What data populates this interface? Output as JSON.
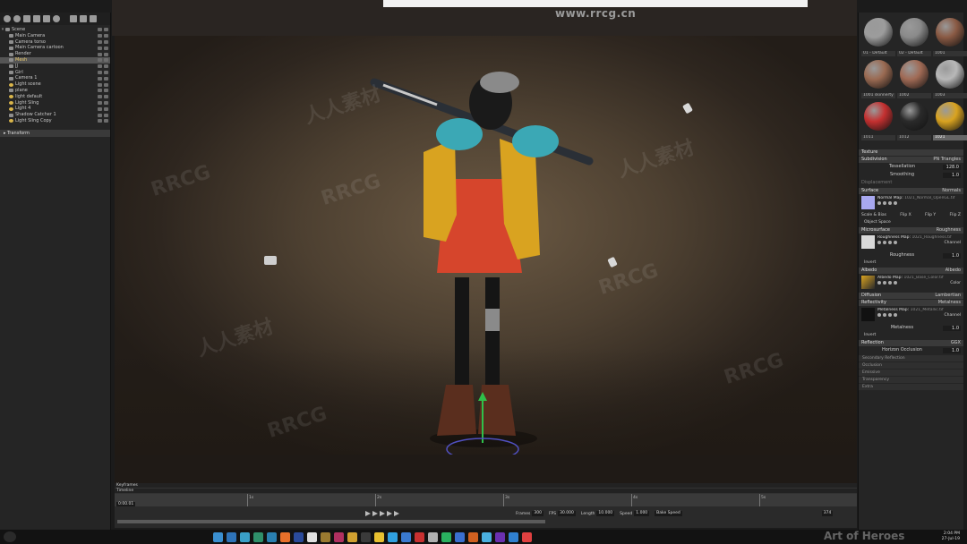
{
  "watermark": {
    "url": "www.rrcg.cn",
    "brand_latin": "RRCG",
    "brand_cn": "人人素材",
    "corner": "Art of Heroes"
  },
  "scene_tree": {
    "items": [
      {
        "label": "Scene",
        "type": "root"
      },
      {
        "label": "Main Camera",
        "type": "camera"
      },
      {
        "label": "Camera torso",
        "type": "camera"
      },
      {
        "label": "Main Camera cartoon",
        "type": "camera"
      },
      {
        "label": "Render",
        "type": "object"
      },
      {
        "label": "Mesh",
        "type": "object",
        "selected": true
      },
      {
        "label": "JJ",
        "type": "object"
      },
      {
        "label": "Girl",
        "type": "object"
      },
      {
        "label": "Camera 1",
        "type": "camera"
      },
      {
        "label": "Light scene",
        "type": "light"
      },
      {
        "label": "plane",
        "type": "object"
      },
      {
        "label": "light default",
        "type": "light"
      },
      {
        "label": "Light Sling",
        "type": "light"
      },
      {
        "label": "Light 4",
        "type": "light"
      },
      {
        "label": "Shadow Catcher 1",
        "type": "object"
      },
      {
        "label": "Light Sling Copy",
        "type": "light"
      }
    ],
    "transform_label": "Transform"
  },
  "materials": [
    {
      "label": "01 - Default",
      "color": "#9c9c9c"
    },
    {
      "label": "02 - Default",
      "color": "#8a8a8a"
    },
    {
      "label": "1001",
      "color": "#8a5a44"
    },
    {
      "label": "1001 skinnerty",
      "color": "#9a6a52"
    },
    {
      "label": "1002",
      "color": "#a06a55"
    },
    {
      "label": "1003",
      "color": "#b8b8b8"
    },
    {
      "label": "1011",
      "color": "#c43030"
    },
    {
      "label": "1012",
      "color": "#2a2a2a"
    },
    {
      "label": "1021",
      "color": "#d9a320",
      "selected": true
    }
  ],
  "properties": {
    "texture_label": "Texture",
    "subdivision": {
      "label": "Subdivision",
      "value": "PN Triangles",
      "tessellation_label": "Tessellation",
      "tessellation": "128.0",
      "smoothing_label": "Smoothing",
      "smoothing": "1.0"
    },
    "displacement": "Displacement",
    "surface": {
      "label": "Surface",
      "value": "Normals",
      "map_label": "Normal Map:",
      "map_file": "1021_Normal_OpenGL.tif",
      "scale_bias": "Scale & Bias",
      "flip_x": "Flip X",
      "flip_y": "Flip Y",
      "flip_z": "Flip Z",
      "object_space": "Object Space"
    },
    "microsurface": {
      "label": "Microsurface",
      "value": "Roughness",
      "map_label": "Roughness Map:",
      "map_file": "1021_Roughness.tif",
      "channel": "Channel",
      "roughness_label": "Roughness",
      "roughness": "1.0",
      "invert": "Invert"
    },
    "albedo": {
      "label": "Albedo",
      "value": "Albedo",
      "map_label": "Albedo Map:",
      "map_file": "1021_Base_Color.tif",
      "color": "Color"
    },
    "diffusion": {
      "label": "Diffusion",
      "value": "Lambertian"
    },
    "reflectivity": {
      "label": "Reflectivity",
      "value": "Metalness",
      "map_label": "Metalness Map:",
      "map_file": "1021_Metallic.tif",
      "channel": "Channel",
      "metalness_label": "Metalness",
      "metalness": "1.0",
      "invert": "Invert"
    },
    "reflection": {
      "label": "Reflection",
      "value": "GGX",
      "horizon_label": "Horizon Occlusion",
      "horizon": "1.0"
    },
    "collapsed": [
      "Secondary Reflection",
      "Occlusion",
      "Emissive",
      "Transparency",
      "Extra"
    ]
  },
  "timeline": {
    "keyframes_label": "Keyframes",
    "timeline_label": "Timeline",
    "current_time": "0:00.01",
    "ticks": [
      "1s",
      "2s",
      "3s",
      "4s",
      "5s"
    ],
    "frames_label": "Frames",
    "frames": "300",
    "fps_label": "FPS",
    "fps": "30.000",
    "length_label": "Length",
    "length": "10.000",
    "speed_label": "Speed",
    "speed": "1.000",
    "bake_label": "Bake Speed",
    "zoom": "374"
  },
  "taskbar": {
    "time": "2:04 PM",
    "date": "27-Jul-19",
    "icons": [
      "#3a8fd0",
      "#2e73b8",
      "#3aa0c8",
      "#2f8f6a",
      "#2a7fb0",
      "#e8702a",
      "#2a4a9a",
      "#e0e0e0",
      "#9a7a30",
      "#b03060",
      "#d0a030",
      "#3a3a3a",
      "#e8c030",
      "#30a0e0",
      "#3a7ad0",
      "#c83030",
      "#b0b0b0",
      "#2ab060",
      "#3a6fd0",
      "#d06020",
      "#4ab0e0",
      "#6a30b0",
      "#3080d0",
      "#e04040"
    ]
  }
}
